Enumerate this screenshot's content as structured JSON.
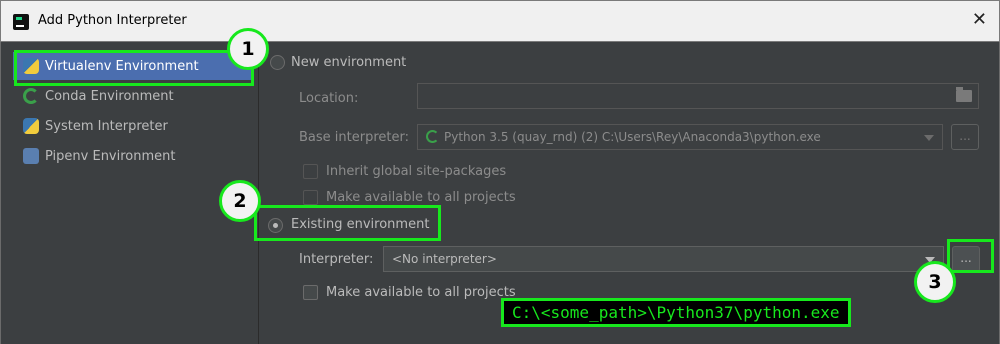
{
  "window": {
    "title": "Add Python Interpreter",
    "close_glyph": "✕",
    "app_icon": "pycharm-icon"
  },
  "sidebar": {
    "items": [
      {
        "label": "Virtualenv Environment",
        "icon": "python-icon",
        "selected": true
      },
      {
        "label": "Conda Environment",
        "icon": "conda-icon",
        "selected": false
      },
      {
        "label": "System Interpreter",
        "icon": "python-icon",
        "selected": false
      },
      {
        "label": "Pipenv Environment",
        "icon": "pipenv-icon",
        "selected": false
      }
    ]
  },
  "new_env": {
    "radio_label": "New environment",
    "selected": false,
    "location_label": "Location:",
    "location_value": "",
    "base_interpreter_label": "Base interpreter:",
    "base_interpreter_value": "Python 3.5 (quay_rnd) (2) C:\\Users\\Rey\\Anaconda3\\python.exe",
    "browse_label": "...",
    "inherit_label": "Inherit global site-packages",
    "make_available_label": "Make available to all projects"
  },
  "existing_env": {
    "radio_label": "Existing environment",
    "selected": true,
    "interpreter_label": "Interpreter:",
    "interpreter_value": "<No interpreter>",
    "browse_label": "...",
    "make_available_label": "Make available to all projects"
  },
  "annotations": {
    "step1": "1",
    "step2": "2",
    "step3": "3",
    "path_hint": "C:\\<some_path>\\Python37\\python.exe",
    "color": "#17e81d"
  }
}
